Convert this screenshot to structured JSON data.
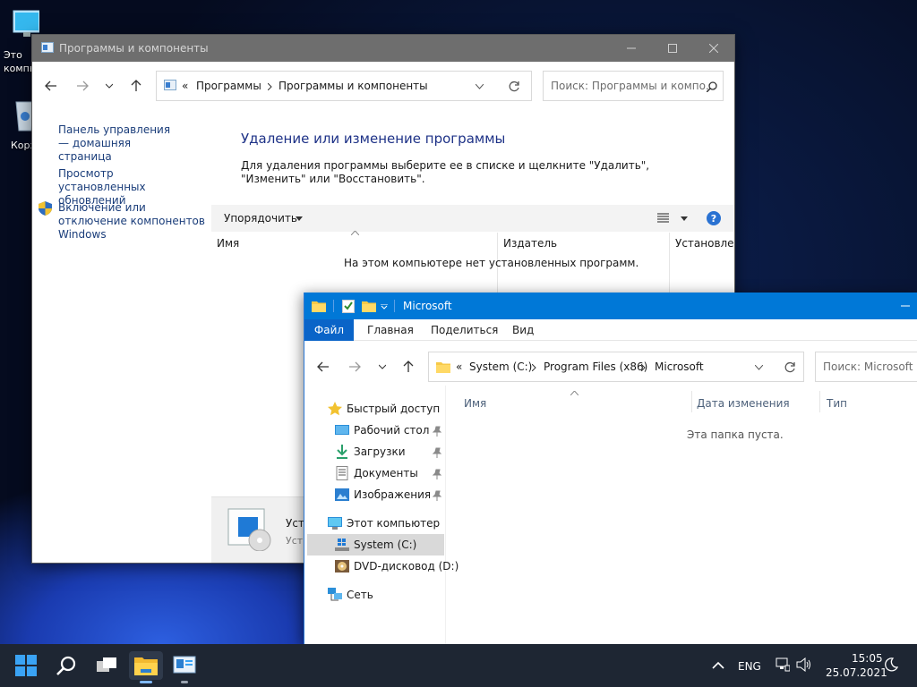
{
  "desktop": {
    "icons": [
      {
        "label": "Это компьютер",
        "icon": "monitor-icon"
      },
      {
        "label": "Корзина",
        "icon": "recycle-bin-icon"
      }
    ]
  },
  "control_panel": {
    "title": "Программы и компоненты",
    "breadcrumb": {
      "prefix": "«",
      "items": [
        "Программы",
        "Программы и компоненты"
      ]
    },
    "search_placeholder": "Поиск: Программы и компо...",
    "sidebar": [
      "Панель управления — домашняя страница",
      "Просмотр установленных обновлений",
      "Включение или отключение компонентов Windows"
    ],
    "heading": "Удаление или изменение программы",
    "description": "Для удаления программы выберите ее в списке и щелкните \"Удалить\", \"Изменить\" или \"Восстановить\".",
    "organize_label": "Упорядочить",
    "columns": [
      "Имя",
      "Издатель",
      "Установле..."
    ],
    "empty_message": "На этом компьютере нет установленных программ.",
    "details": {
      "line1": "Уста",
      "line2": "Уст"
    }
  },
  "explorer": {
    "title": "Microsoft",
    "ribbon_tabs": [
      "Файл",
      "Главная",
      "Поделиться",
      "Вид"
    ],
    "breadcrumb": {
      "prefix": "«",
      "items": [
        "System (C:)",
        "Program Files (x86)",
        "Microsoft"
      ]
    },
    "search_placeholder": "Поиск: Microsoft",
    "nav": {
      "quick_access": "Быстрый доступ",
      "pinned": [
        "Рабочий стол",
        "Загрузки",
        "Документы",
        "Изображения"
      ],
      "this_pc": "Этот компьютер",
      "drives": [
        "System (C:)",
        "DVD-дисковод (D:)"
      ],
      "network": "Сеть"
    },
    "columns": [
      "Имя",
      "Дата изменения",
      "Тип"
    ],
    "empty_message": "Эта папка пуста."
  },
  "taskbar": {
    "language": "ENG",
    "time": "15:05",
    "date": "25.07.2021"
  },
  "colors": {
    "accent": "#0078d7",
    "taskbar": "#1e2633",
    "link": "#1a3d7a",
    "heading": "#1e3287"
  }
}
